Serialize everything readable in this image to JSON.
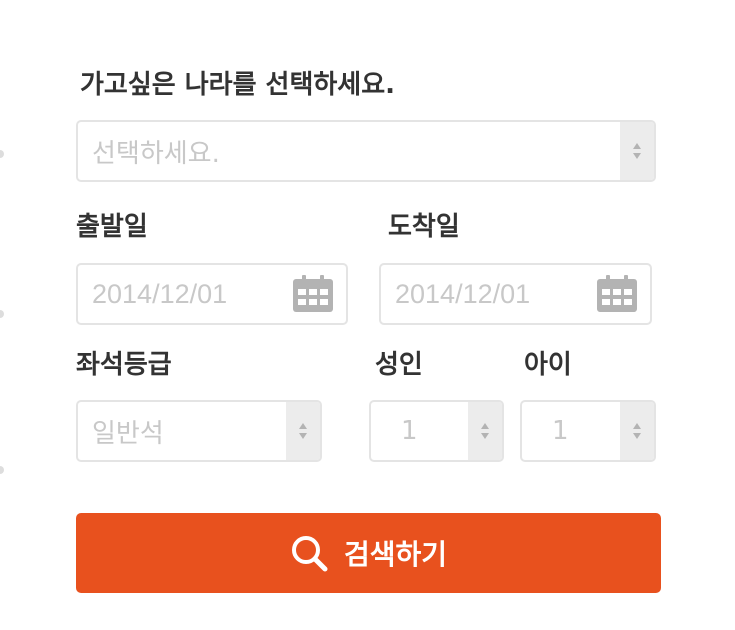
{
  "destination": {
    "label": "가고싶은 나라를 선택하세요.",
    "placeholder": "선택하세요."
  },
  "departure": {
    "label": "출발일",
    "value": "2014/12/01"
  },
  "arrival": {
    "label": "도착일",
    "value": "2014/12/01"
  },
  "seat_class": {
    "label": "좌석등급",
    "value": "일반석"
  },
  "adults": {
    "label": "성인",
    "value": "1"
  },
  "children": {
    "label": "아이",
    "value": "1"
  },
  "search_button": {
    "label": "검색하기",
    "icon": "search-icon"
  },
  "colors": {
    "accent": "#e8511e",
    "label_text": "#333333",
    "placeholder_text": "#c8c8c8",
    "border": "#e4e4e4",
    "spinner_bg": "#ececec",
    "icon_gray": "#b3b3b3"
  }
}
